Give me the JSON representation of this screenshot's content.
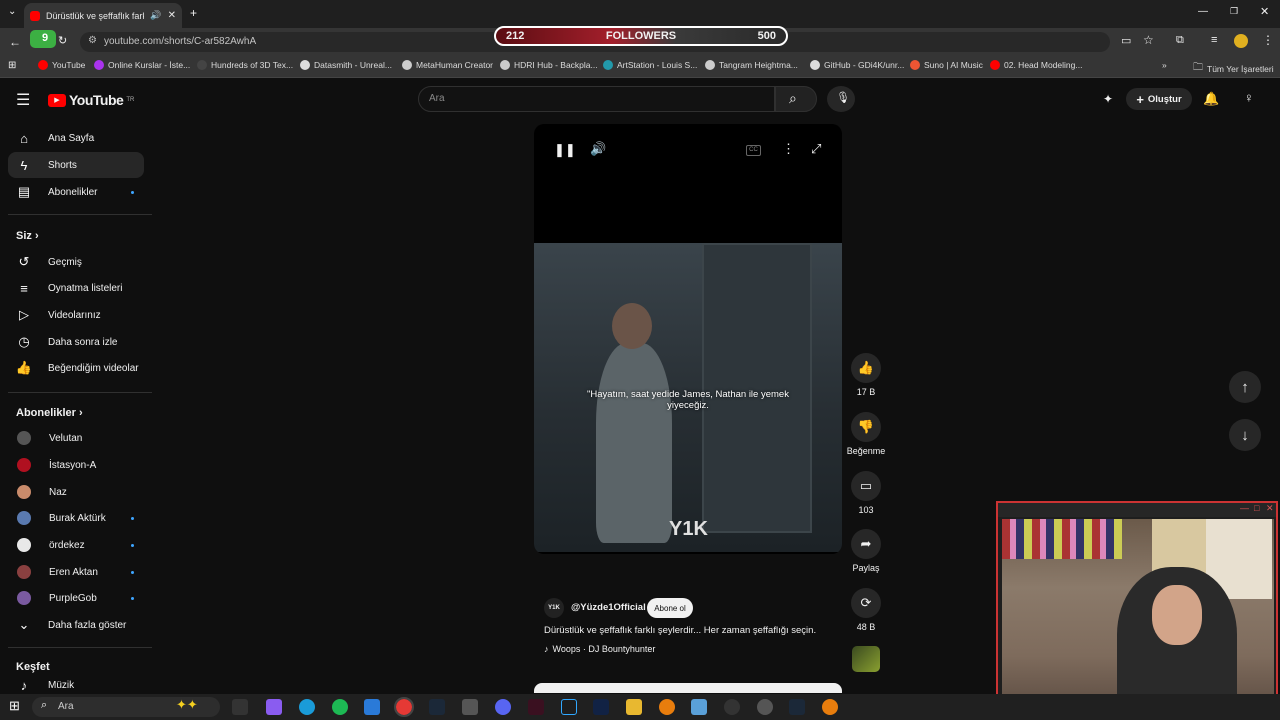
{
  "browser": {
    "tab_title": "Dürüstlük ve şeffaflık farklı ş",
    "url": "youtube.com/shorts/C-ar582AwhA",
    "profile_badge": "9"
  },
  "overlay": {
    "followers_current": "212",
    "followers_label": "FOLLOWERS",
    "followers_goal": "500"
  },
  "bookmarks": [
    "YouTube",
    "Online Kurslar - İste...",
    "Hundreds of 3D Tex...",
    "Datasmith - Unreal...",
    "MetaHuman Creator",
    "HDRI Hub - Backpla...",
    "ArtStation - Louis S...",
    "Tangram Heightma...",
    "GitHub - GDi4K/unr...",
    "Suno | AI Music",
    "02. Head Modeling..."
  ],
  "bookmarks_all": "Tüm Yer İşaretleri",
  "youtube": {
    "logo": "YouTube",
    "logo_region": "TR",
    "search_placeholder": "Ara",
    "create_label": "Oluştur",
    "sidebar": {
      "main": [
        "Ana Sayfa",
        "Shorts",
        "Abonelikler"
      ],
      "you_header": "Siz",
      "you": [
        "Geçmiş",
        "Oynatma listeleri",
        "Videolarınız",
        "Daha sonra izle",
        "Beğendiğim videolar"
      ],
      "subs_header": "Abonelikler",
      "subs": [
        "Velutan",
        "İstasyon-A",
        "Naz",
        "Burak Aktürk",
        "ördekez",
        "Eren Aktan",
        "PurpleGob"
      ],
      "show_more": "Daha fazla göster",
      "explore_header": "Keşfet",
      "explore": [
        "Müzik"
      ]
    },
    "short": {
      "subtitle": "\"Hayatım, saat yedide James, Nathan ile yemek yiyeceğiz.",
      "watermark": "Y1K",
      "channel_avatar": "Y1K",
      "channel": "@Yüzde1Official",
      "subscribe": "Abone ol",
      "description": "Dürüstlük ve şeffaflık farklı şeylerdir... Her zaman şeffaflığı seçin.",
      "music": "Woops · DJ Bountyhunter"
    },
    "actions": {
      "likes": "17 B",
      "dislike": "Beğenme",
      "comments": "103",
      "share": "Paylaş",
      "remix": "48 B"
    }
  },
  "taskbar": {
    "search": "Ara"
  }
}
